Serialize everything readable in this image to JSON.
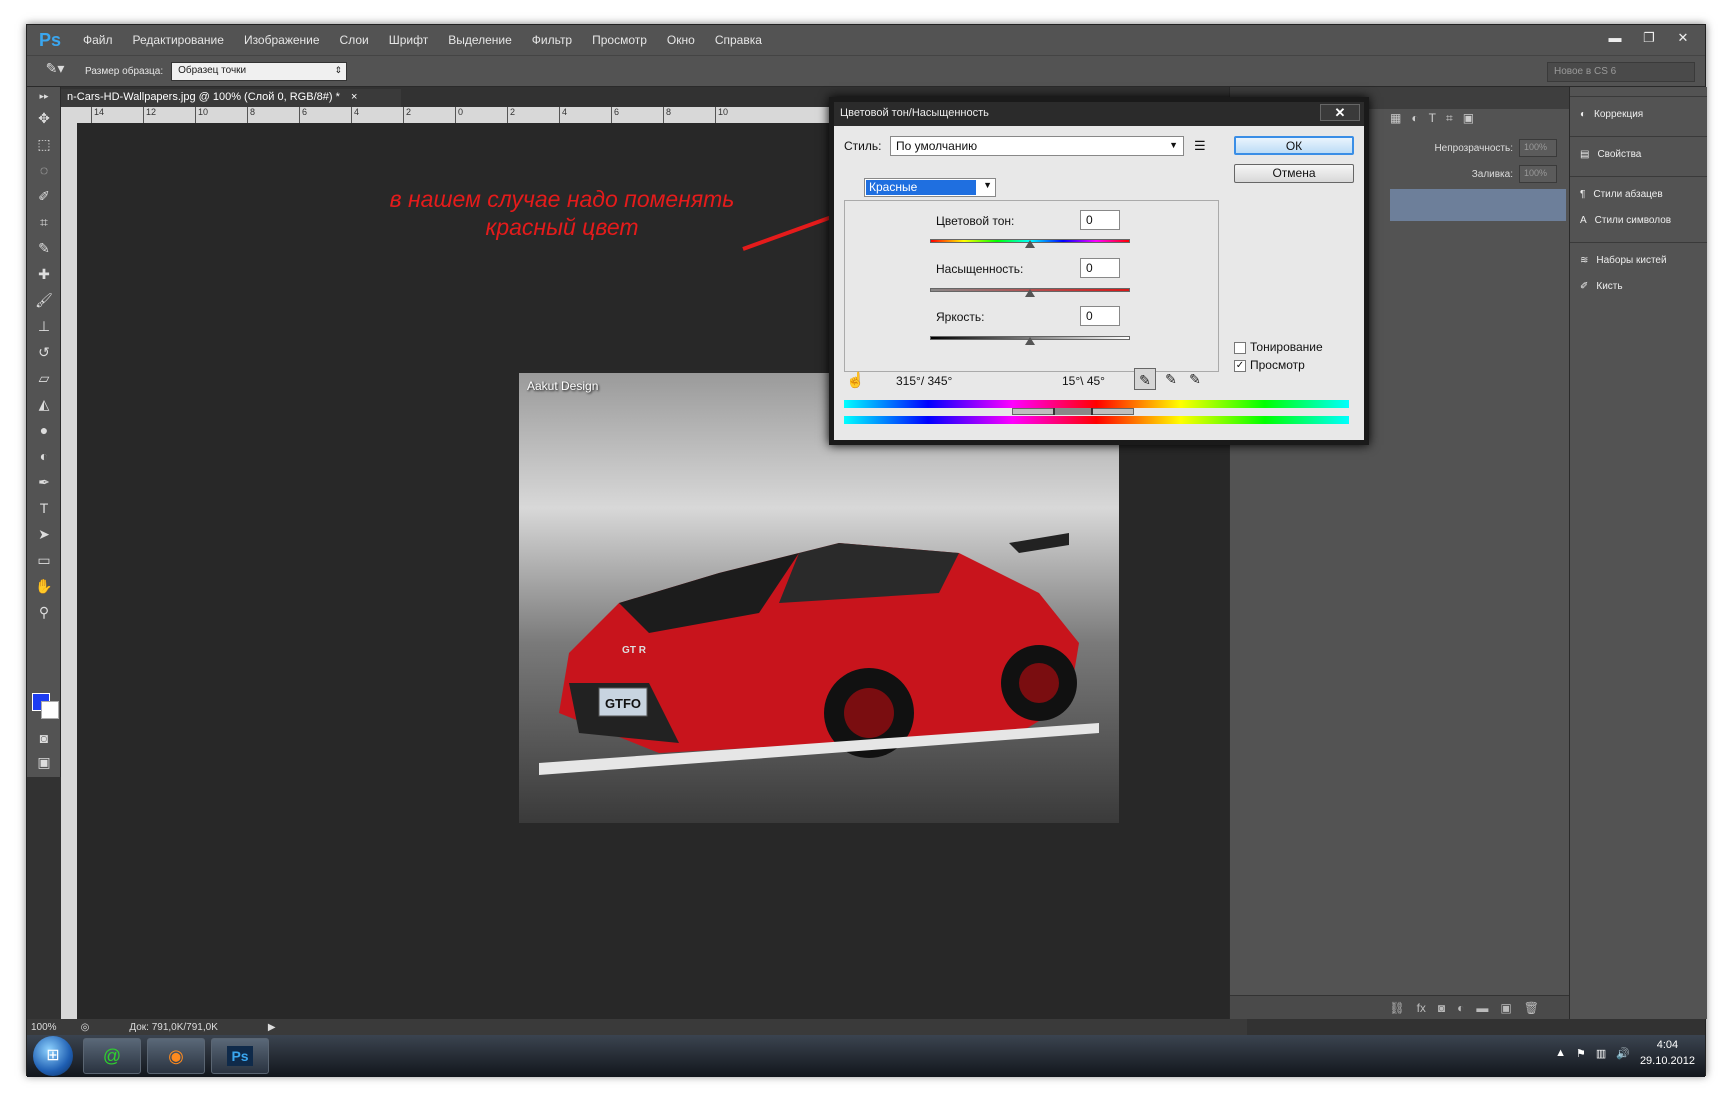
{
  "app": {
    "logo": "Ps"
  },
  "menu": [
    "Файл",
    "Редактирование",
    "Изображение",
    "Слои",
    "Шрифт",
    "Выделение",
    "Фильтр",
    "Просмотр",
    "Окно",
    "Справка"
  ],
  "window_controls": {
    "minimize": "▬",
    "restore": "❐",
    "close": "✕"
  },
  "options_bar": {
    "sample_size_label": "Размер образца:",
    "sample_size_value": "Образец точки",
    "workspace": "Новое в CS 6"
  },
  "document": {
    "tab_title": "n-Cars-HD-Wallpapers.jpg @ 100% (Слой 0, RGB/8#) *",
    "tab_close": "×",
    "art_logo": "Aakut Design",
    "license_plate": "GTFO",
    "badge": "GT R"
  },
  "ruler_ticks": [
    "14",
    "12",
    "10",
    "8",
    "6",
    "4",
    "2",
    "0",
    "2",
    "4",
    "6",
    "8",
    "10"
  ],
  "annotation": {
    "line1": "в нашем случае надо поменять",
    "line2": "красный цвет"
  },
  "dialog": {
    "title": "Цветовой тон/Насыщенность",
    "close": "✕",
    "style_label": "Стиль:",
    "style_value": "По умолчанию",
    "channel": "Красные",
    "hue_label": "Цветовой тон:",
    "hue_value": "0",
    "saturation_label": "Насыщенность:",
    "saturation_value": "0",
    "lightness_label": "Яркость:",
    "lightness_value": "0",
    "range_left": "315°/ 345°",
    "range_right": "15°\\ 45°",
    "ok": "ОК",
    "cancel": "Отмена",
    "colorize_label": "Тонирование",
    "colorize_checked": false,
    "preview_label": "Просмотр",
    "preview_checked": true
  },
  "layers_panel": {
    "opacity_label": "Непрозрачность:",
    "opacity_value": "100%",
    "fill_label": "Заливка:",
    "fill_value": "100%"
  },
  "right_dock": [
    {
      "label": "Коррекция",
      "icon": "adjustments-icon"
    },
    {
      "label": "Свойства",
      "icon": "properties-icon"
    },
    {
      "label": "Стили абзацев",
      "icon": "paragraph-styles-icon"
    },
    {
      "label": "Стили символов",
      "icon": "character-styles-icon"
    },
    {
      "label": "Наборы кистей",
      "icon": "brush-presets-icon"
    },
    {
      "label": "Кисть",
      "icon": "brush-icon"
    }
  ],
  "status_bar": {
    "zoom": "100%",
    "doc_info": "Док: 791,0K/791,0K"
  },
  "taskbar": {
    "time": "4:04",
    "date": "29.10.2012",
    "ps_button": "Ps"
  },
  "colors": {
    "foreground": "#1c3cf2",
    "background": "#ffffff",
    "annotation": "#e51b1b"
  }
}
